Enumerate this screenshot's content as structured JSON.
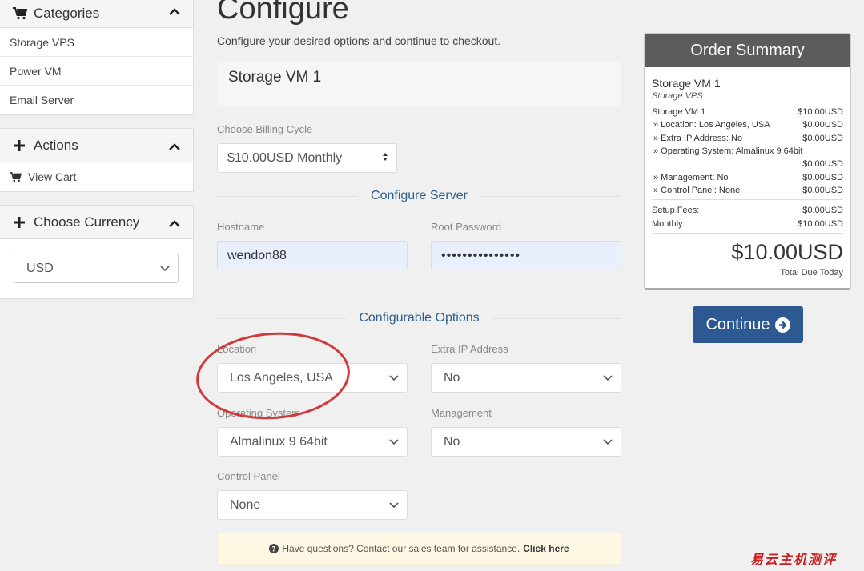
{
  "sidebar": {
    "categories": {
      "title": "Categories",
      "items": [
        "Storage VPS",
        "Power VM",
        "Email Server"
      ]
    },
    "actions": {
      "title": "Actions",
      "items": [
        "View Cart"
      ]
    },
    "currency": {
      "title": "Choose Currency",
      "selected": "USD"
    }
  },
  "main": {
    "title": "Configure",
    "subtitle": "Configure your desired options and continue to checkout.",
    "product_name": "Storage VM 1",
    "billing_label": "Choose Billing Cycle",
    "billing_value": "$10.00USD Monthly",
    "configure_server_heading": "Configure Server",
    "hostname_label": "Hostname",
    "hostname_value": "wendon88",
    "root_password_label": "Root Password",
    "root_password_value": "•••••••••••••••",
    "configurable_options_heading": "Configurable Options",
    "options": {
      "location": {
        "label": "Location",
        "value": "Los Angeles, USA"
      },
      "extra_ip": {
        "label": "Extra IP Address",
        "value": "No"
      },
      "os": {
        "label": "Operating System",
        "value": "Almalinux 9 64bit"
      },
      "management": {
        "label": "Management",
        "value": "No"
      },
      "control_panel": {
        "label": "Control Panel",
        "value": "None"
      }
    },
    "help_text": "Have questions? Contact our sales team for assistance.",
    "help_link": "Click here"
  },
  "summary": {
    "title": "Order Summary",
    "product_name": "Storage VM 1",
    "product_group": "Storage VPS",
    "lines": [
      {
        "label": "Storage VM 1",
        "value": "$10.00USD"
      },
      {
        "label": "» Location: Los Angeles, USA",
        "value": "$0.00USD"
      },
      {
        "label": "» Extra IP Address: No",
        "value": "$0.00USD"
      },
      {
        "label": "» Operating System: Almalinux 9 64bit",
        "value": ""
      },
      {
        "label": "",
        "value": "$0.00USD"
      },
      {
        "label": "» Management: No",
        "value": "$0.00USD"
      },
      {
        "label": "» Control Panel: None",
        "value": "$0.00USD"
      }
    ],
    "setup_fees_label": "Setup Fees:",
    "setup_fees_value": "$0.00USD",
    "monthly_label": "Monthly:",
    "monthly_value": "$10.00USD",
    "total": "$10.00USD",
    "total_label": "Total Due Today"
  },
  "continue_label": "Continue",
  "watermark": "易云主机测评",
  "colors": {
    "primary_button": "#2d5993",
    "heading_blue": "#2b5f8a",
    "annotation_red": "#d13a3a",
    "summary_header": "#5c5c5c"
  }
}
